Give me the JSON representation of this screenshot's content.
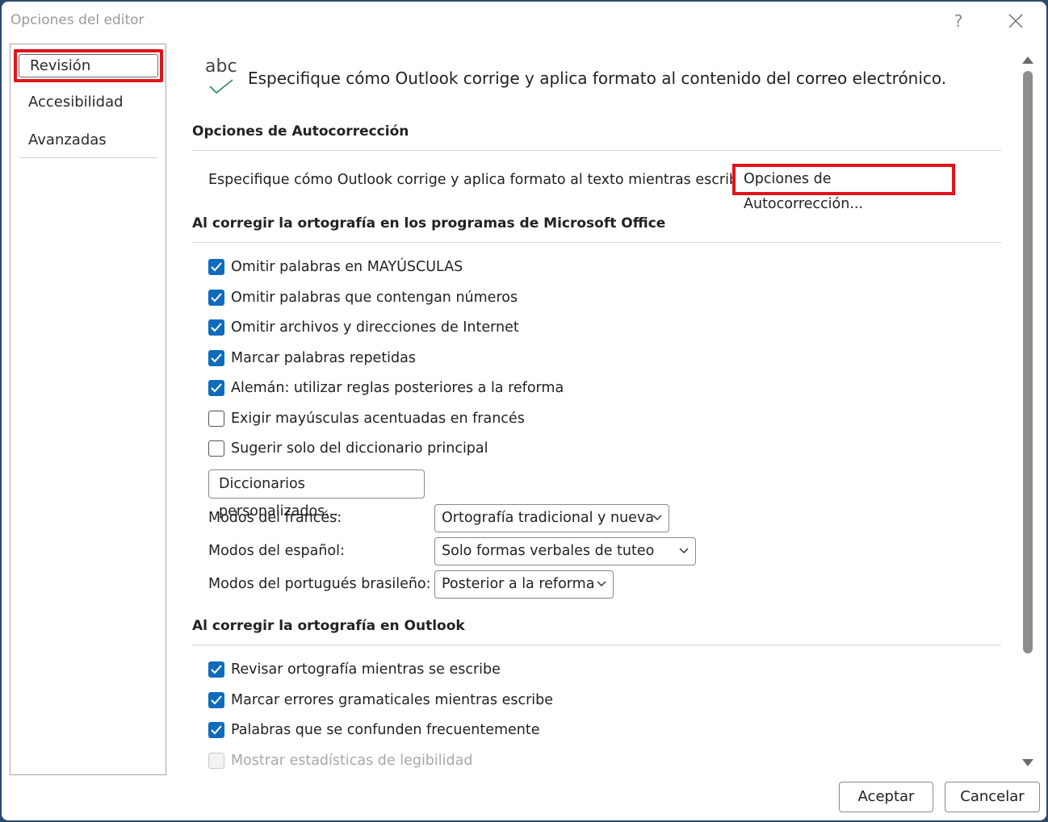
{
  "window": {
    "title": "Opciones del editor",
    "help_label": "?"
  },
  "sidebar": {
    "items": [
      {
        "label": "Revisión",
        "selected": true
      },
      {
        "label": "Accesibilidad",
        "selected": false
      },
      {
        "label": "Avanzadas",
        "selected": false
      }
    ]
  },
  "header": {
    "icon_text": "abc",
    "text": "Especifique cómo Outlook corrige y aplica formato al contenido del correo electrónico."
  },
  "autocorrect": {
    "title": "Opciones de Autocorrección",
    "description": "Especifique cómo Outlook corrige y aplica formato al texto mientras escribe.",
    "button_label": "Opciones de Autocorrección..."
  },
  "office_spelling": {
    "title": "Al corregir la ortografía en los programas de Microsoft Office",
    "checkboxes": [
      {
        "label": "Omitir palabras en MAYÚSCULAS",
        "checked": true
      },
      {
        "label": "Omitir palabras que contengan números",
        "checked": true
      },
      {
        "label": "Omitir archivos y direcciones de Internet",
        "checked": true
      },
      {
        "label": "Marcar palabras repetidas",
        "checked": true
      },
      {
        "label": "Alemán: utilizar reglas posteriores a la reforma",
        "checked": true
      },
      {
        "label": "Exigir mayúsculas acentuadas en francés",
        "checked": false
      },
      {
        "label": "Sugerir solo del diccionario principal",
        "checked": false
      }
    ],
    "dictionaries_button": "Diccionarios personalizados...",
    "modes": [
      {
        "label": "Modos del francés:",
        "value": "Ortografía tradicional y nueva"
      },
      {
        "label": "Modos del español:",
        "value": "Solo formas verbales de tuteo"
      },
      {
        "label": "Modos del portugués brasileño:",
        "value": "Posterior a la reforma"
      }
    ]
  },
  "outlook_spelling": {
    "title": "Al corregir la ortografía en Outlook",
    "checkboxes": [
      {
        "label": "Revisar ortografía mientras se escribe",
        "checked": true
      },
      {
        "label": "Marcar errores gramaticales mientras escribe",
        "checked": true
      },
      {
        "label": "Palabras que se confunden frecuentemente",
        "checked": true
      },
      {
        "label": "Mostrar estadísticas de legibilidad",
        "checked": false,
        "disabled": true
      }
    ]
  },
  "footer": {
    "ok_label": "Aceptar",
    "cancel_label": "Cancelar"
  },
  "colors": {
    "accent": "#0f6cbd",
    "highlight": "#e0141c",
    "check_icon": "#2e8b57"
  }
}
